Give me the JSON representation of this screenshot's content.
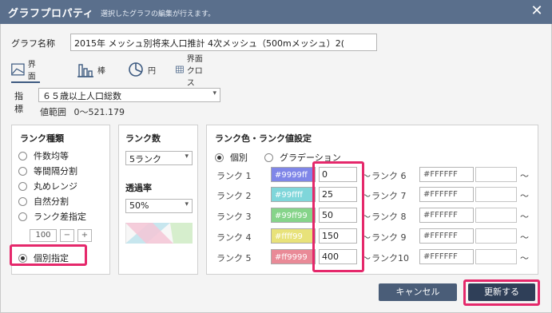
{
  "dialog": {
    "title": "グラフプロパティ",
    "subtitle": "選択したグラフの編集が行えます。",
    "close_label": "✕"
  },
  "graph_name": {
    "label": "グラフ名称",
    "value": "2015年 メッシュ別将来人口推計 4次メッシュ（500mメッシュ）2("
  },
  "tabs": [
    {
      "label": "界面",
      "icon": "area-chart-icon"
    },
    {
      "label": "棒",
      "icon": "bar-chart-icon"
    },
    {
      "label": "円",
      "icon": "pie-chart-icon"
    },
    {
      "label": "界面クロス",
      "icon": "grid-table-icon"
    }
  ],
  "index": {
    "label": "指標",
    "selected": "６５歳以上人口総数",
    "range_label": "値範囲",
    "range_value": "0～521.179"
  },
  "rank_type": {
    "title": "ランク種類",
    "options": [
      {
        "label": "件数均等",
        "checked": false
      },
      {
        "label": "等間隔分割",
        "checked": false
      },
      {
        "label": "丸めレンジ",
        "checked": false
      },
      {
        "label": "自然分割",
        "checked": false
      },
      {
        "label": "ランク差指定",
        "checked": false
      },
      {
        "label": "個別指定",
        "checked": true
      }
    ],
    "stepper": {
      "value": "100",
      "minus": "−",
      "plus": "+"
    }
  },
  "rank_count": {
    "title": "ランク数",
    "selected": "5ランク",
    "transparency_title": "透過率",
    "transparency_selected": "50%"
  },
  "rank_color": {
    "title": "ランク色・ランク値設定",
    "mode_options": [
      {
        "label": "個別",
        "checked": true
      },
      {
        "label": "グラデーション",
        "checked": false
      }
    ],
    "left_ranks": [
      {
        "label": "ランク 1",
        "color_code": "#9999ff",
        "color": "#9999ff",
        "value": "0"
      },
      {
        "label": "ランク 2",
        "color_code": "#99ffff",
        "color": "#99ffff",
        "value": "25"
      },
      {
        "label": "ランク 3",
        "color_code": "#99ff99",
        "color": "#99ff99",
        "value": "50"
      },
      {
        "label": "ランク 4",
        "color_code": "#ffff99",
        "color": "#ffff99",
        "value": "150"
      },
      {
        "label": "ランク 5",
        "color_code": "#ff9999",
        "color": "#ff9999",
        "value": "400"
      }
    ],
    "right_ranks": [
      {
        "label": "ランク 6",
        "color_code": "#FFFFFF"
      },
      {
        "label": "ランク 7",
        "color_code": "#FFFFFF"
      },
      {
        "label": "ランク 8",
        "color_code": "#FFFFFF"
      },
      {
        "label": "ランク 9",
        "color_code": "#FFFFFF"
      },
      {
        "label": "ランク10",
        "color_code": "#FFFFFF"
      }
    ],
    "tilde": "～"
  },
  "buttons": {
    "cancel": "キャンセル",
    "update": "更新する"
  },
  "colors": {
    "titlebar": "#5a6f8c",
    "accent": "#3d5a80",
    "highlight": "#e5286b",
    "cancel_button": "#4a5d78",
    "update_button": "#2f3f58"
  }
}
